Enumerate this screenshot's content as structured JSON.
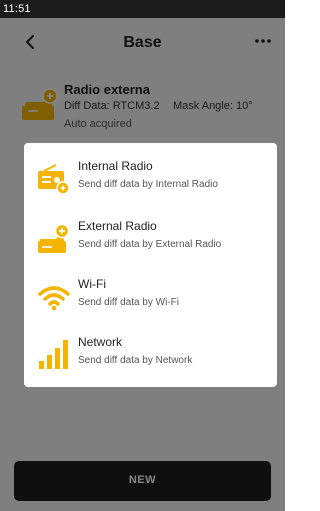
{
  "status_bar": {
    "time": "11:51"
  },
  "header": {
    "title": "Base"
  },
  "current_station": {
    "name": "Radio externa",
    "diff_data": "Diff Data: RTCM3.2",
    "mask_angle": "Mask Angle: 10°",
    "status": "Auto acquired"
  },
  "dialog": {
    "options": [
      {
        "title": "Internal Radio",
        "description": "Send diff data by Internal Radio",
        "icon": "internal-radio-icon"
      },
      {
        "title": "External Radio",
        "description": "Send diff data by External Radio",
        "icon": "external-radio-icon"
      },
      {
        "title": "Wi-Fi",
        "description": "Send diff data by Wi-Fi",
        "icon": "wifi-icon"
      },
      {
        "title": "Network",
        "description": "Send diff data by Network",
        "icon": "network-signal-icon"
      }
    ]
  },
  "new_button": {
    "label": "NEW"
  },
  "colors": {
    "accent": "#f5b400",
    "button": "#1d1d1d"
  }
}
